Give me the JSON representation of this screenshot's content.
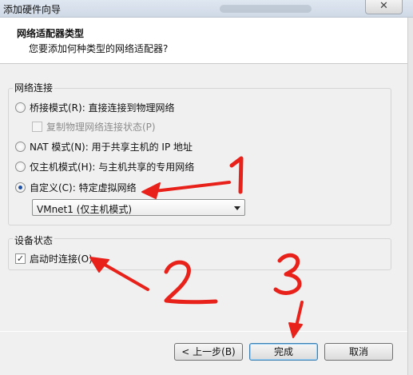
{
  "window": {
    "title": "添加硬件向导",
    "close_glyph": "✕"
  },
  "header": {
    "title": "网络适配器类型",
    "subtitle": "您要添加何种类型的网络适配器?"
  },
  "network_group": {
    "label": "网络连接",
    "options": [
      {
        "label": "桥接模式(R): 直接连接到物理网络",
        "checked": false
      },
      {
        "label": "复制物理网络连接状态(P)",
        "checked": false,
        "disabled": true
      },
      {
        "label": "NAT 模式(N): 用于共享主机的 IP 地址",
        "checked": false
      },
      {
        "label": "仅主机模式(H): 与主机共享的专用网络",
        "checked": false
      },
      {
        "label": "自定义(C): 特定虚拟网络",
        "checked": true
      }
    ],
    "dropdown_value": "VMnet1 (仅主机模式)"
  },
  "device_group": {
    "label": "设备状态",
    "connect_on_start": {
      "label": "启动时连接(O)",
      "checked": true,
      "check_glyph": "✓"
    }
  },
  "buttons": {
    "back": "< 上一步(B)",
    "finish": "完成",
    "cancel": "取消"
  },
  "colors": {
    "annotation": "#e8211b"
  },
  "annotations": [
    "1",
    "2",
    "3"
  ]
}
